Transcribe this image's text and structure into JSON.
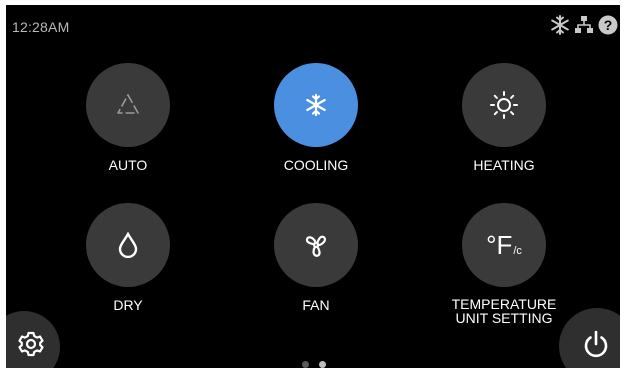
{
  "status": {
    "time": "12:28AM",
    "icons": [
      "snowflake-icon",
      "network-icon",
      "help-icon"
    ]
  },
  "modes": [
    {
      "label": "AUTO",
      "icon": "auto-icon",
      "active": false
    },
    {
      "label": "COOLING",
      "icon": "snowflake-icon",
      "active": true
    },
    {
      "label": "HEATING",
      "icon": "sun-icon",
      "active": false
    },
    {
      "label": "DRY",
      "icon": "droplet-icon",
      "active": false
    },
    {
      "label": "FAN",
      "icon": "fan-icon",
      "active": false
    },
    {
      "label": "TEMPERATURE\nUNIT  SETTING",
      "icon": "temperature-unit-icon",
      "active": false,
      "glyph_main": "°F",
      "glyph_sub": "/c"
    }
  ],
  "pager": {
    "pages": 2,
    "current": 2
  },
  "colors": {
    "background": "#000000",
    "button": "#3a3a3a",
    "accent": "#4a8fe0",
    "text": "#ffffff"
  }
}
